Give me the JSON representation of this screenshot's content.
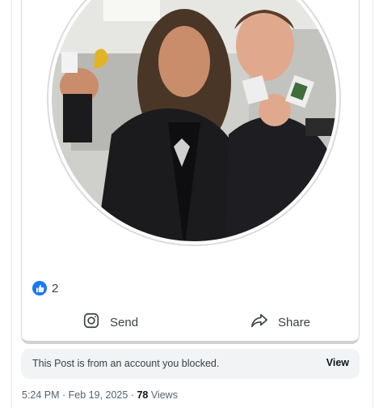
{
  "post": {
    "reactions": {
      "icon": "thumbs-up-icon",
      "count": "2",
      "color": "#1877f2"
    },
    "actions": [
      {
        "label": "Send",
        "icon": "instagram-icon"
      },
      {
        "label": "Share",
        "icon": "share-icon"
      }
    ]
  },
  "blocked_notice": {
    "text": "This Post is from an account you blocked.",
    "view_label": "View"
  },
  "meta": {
    "timestamp": "5:24 PM · Feb 19, 2025 · ",
    "views_count": "78",
    "views_label": " Views"
  }
}
